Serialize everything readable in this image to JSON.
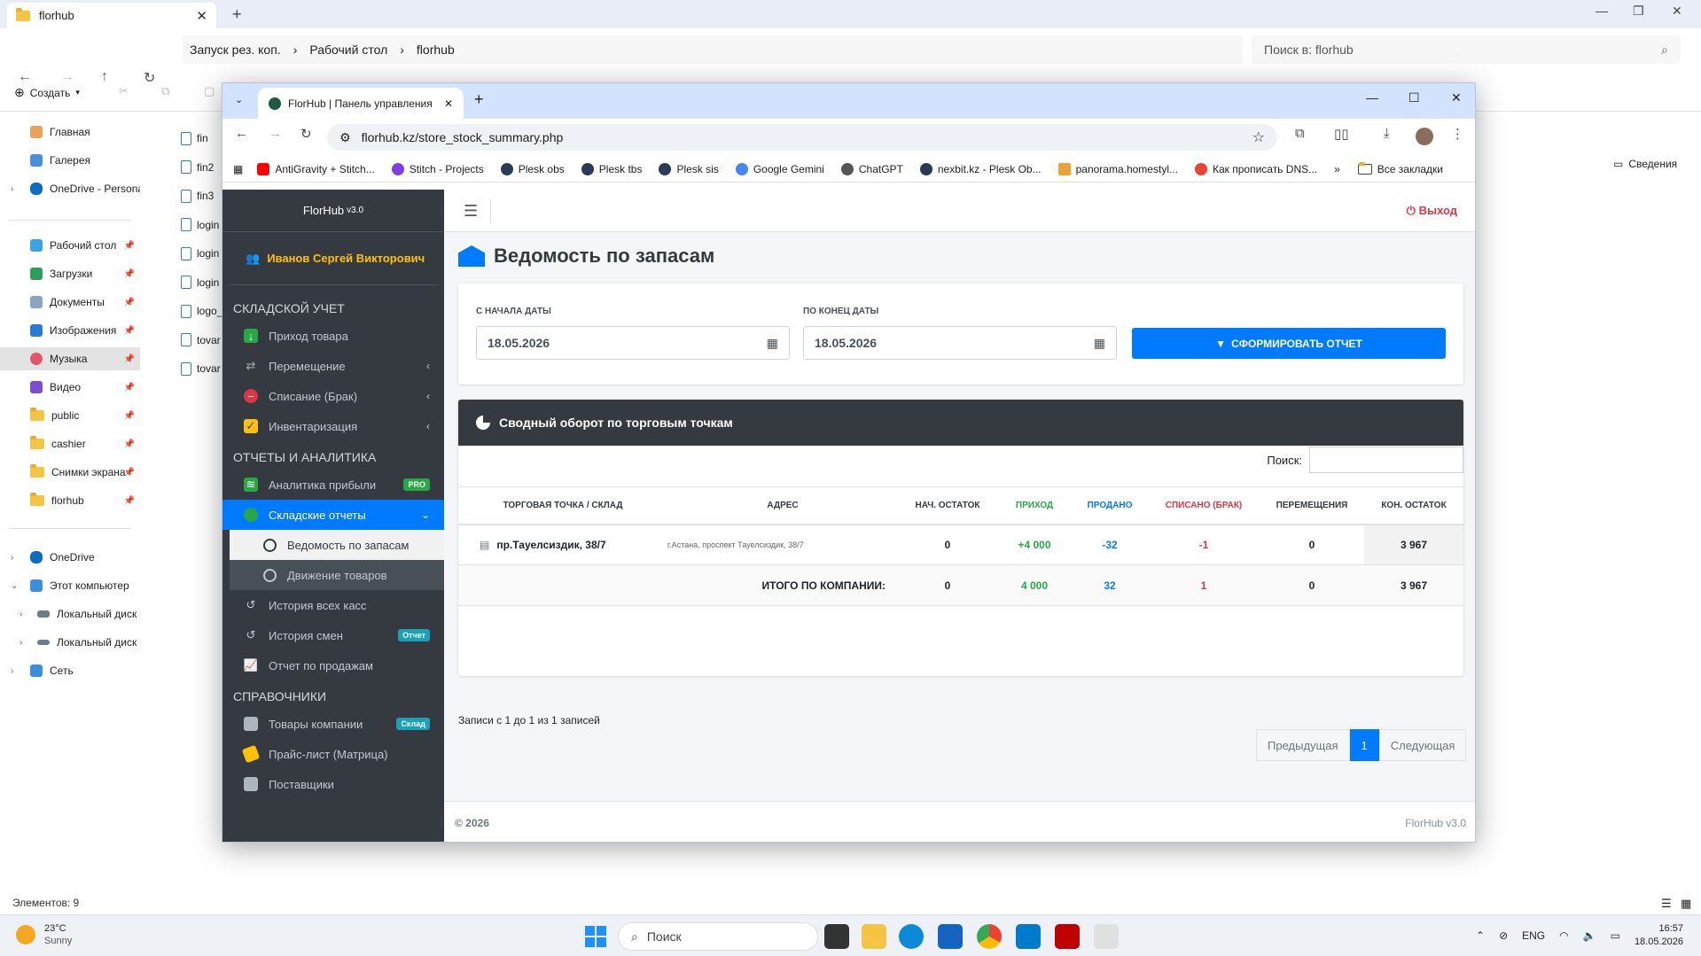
{
  "explorer": {
    "tab_title": "florhub",
    "breadcrumb": [
      "Запуск рез. коп.",
      "Рабочий стол",
      "florhub"
    ],
    "search_placeholder": "Поиск в: florhub",
    "create_label": "Создать",
    "details_label": "Сведения",
    "sidebar": [
      {
        "label": "Главная"
      },
      {
        "label": "Галерея"
      },
      {
        "label": "OneDrive - Persona"
      },
      {
        "label": "Рабочий стол"
      },
      {
        "label": "Загрузки"
      },
      {
        "label": "Документы"
      },
      {
        "label": "Изображения"
      },
      {
        "label": "Музыка"
      },
      {
        "label": "Видео"
      },
      {
        "label": "public"
      },
      {
        "label": "cashier"
      },
      {
        "label": "Снимки экрана"
      },
      {
        "label": "florhub"
      },
      {
        "label": "OneDrive"
      },
      {
        "label": "Этот компьютер"
      },
      {
        "label": "Локальный диск"
      },
      {
        "label": "Локальный диск"
      },
      {
        "label": "Сеть"
      }
    ],
    "files": [
      "fin",
      "fin2",
      "fin3",
      "login",
      "login",
      "login",
      "logo_",
      "tovar",
      "tovar"
    ],
    "status": "Элементов: 9"
  },
  "browser": {
    "tab_title": "FlorHub | Панель управления",
    "url": "florhub.kz/store_stock_summary.php",
    "bookmarks": [
      {
        "label": "AntiGravity + Stitch...",
        "color": "#ff0000"
      },
      {
        "label": "Stitch - Projects",
        "color": "#7b3fe4"
      },
      {
        "label": "Plesk obs",
        "color": "#2b3a55"
      },
      {
        "label": "Plesk tbs",
        "color": "#2b3a55"
      },
      {
        "label": "Plesk sis",
        "color": "#2b3a55"
      },
      {
        "label": "Google Gemini",
        "color": "#4285f4"
      },
      {
        "label": "ChatGPT",
        "color": "#555555"
      },
      {
        "label": "nexbit.kz - Plesk Ob...",
        "color": "#2b3a55"
      },
      {
        "label": "panorama.homestyl...",
        "color": "#e8a33d"
      },
      {
        "label": "Как прописать DNS...",
        "color": "#ea4335"
      }
    ],
    "all_bookmarks": "Все закладки"
  },
  "app": {
    "brand": "FlorHub",
    "version": "v3.0",
    "user": "Иванов Сергей Викторович",
    "logout": "Выход",
    "sections": {
      "warehouse": "СКЛАДСКОЙ УЧЕТ",
      "reports": "ОТЧЕТЫ И АНАЛИТИКА",
      "refs": "СПРАВОЧНИКИ"
    },
    "nav": {
      "income": "Приход товара",
      "move": "Перемещение",
      "writeoff": "Списание (Брак)",
      "inventory": "Инвентаризация",
      "profit": "Аналитика прибыли",
      "profit_badge": "PRO",
      "stock_reports": "Складские отчеты",
      "stock_summary": "Ведомость по запасам",
      "goods_movement": "Движение товаров",
      "cash_history": "История всех касс",
      "shift_history": "История смен",
      "shift_badge": "Отчет",
      "sales_report": "Отчет по продажам",
      "company_goods": "Товары компании",
      "company_goods_badge": "Склад",
      "price_list": "Прайс-лист (Матрица)",
      "suppliers": "Поставщики"
    },
    "page_title": "Ведомость по запасам",
    "filter": {
      "from_label": "С НАЧАЛА ДАТЫ",
      "from_value": "18.05.2026",
      "to_label": "ПО КОНЕЦ ДАТЫ",
      "to_value": "18.05.2026",
      "button": "СФОРМИРОВАТЬ ОТЧЕТ"
    },
    "card_title": "Сводный оборот по торговым точкам",
    "search_label": "Поиск:",
    "columns": [
      "ТОРГОВАЯ ТОЧКА / СКЛАД",
      "АДРЕС",
      "НАЧ. ОСТАТОК",
      "ПРИХОД",
      "ПРОДАНО",
      "СПИСАНО (БРАК)",
      "ПЕРЕМЕЩЕНИЯ",
      "КОН. ОСТАТОК"
    ],
    "row": {
      "store": "пр.Тауелсиздик, 38/7",
      "address": "г.Астана, проспект Тауелсиздик, 38/7",
      "start": "0",
      "income": "+4 000",
      "sold": "-32",
      "writeoff": "-1",
      "moves": "0",
      "end": "3 967"
    },
    "total": {
      "label": "ИТОГО ПО КОМПАНИИ:",
      "start": "0",
      "income": "4 000",
      "sold": "32",
      "writeoff": "1",
      "moves": "0",
      "end": "3 967"
    },
    "info": "Записи с 1 до 1 из 1 записей",
    "pager": {
      "prev": "Предыдущая",
      "page": "1",
      "next": "Следующая"
    },
    "footer_left": "© 2026",
    "footer_right": "FlorHub v3.0"
  },
  "taskbar": {
    "temp": "23°C",
    "weather": "Sunny",
    "search": "Поиск",
    "lang": "ENG",
    "time": "16:57",
    "date": "18.05.2026"
  }
}
